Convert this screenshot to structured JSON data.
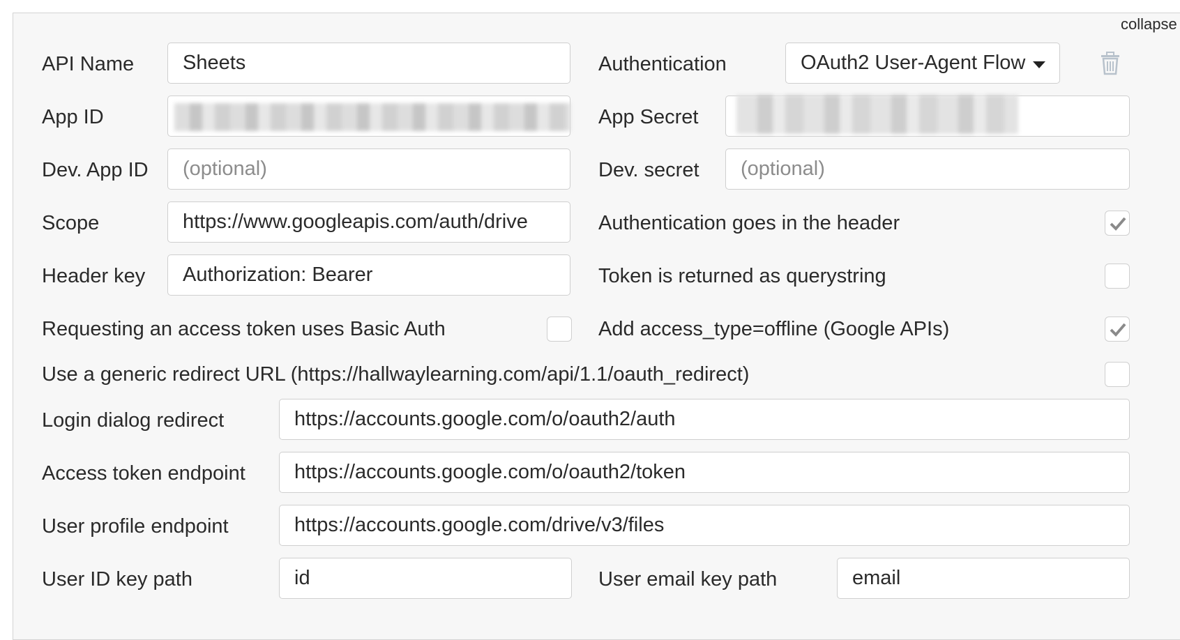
{
  "header": {
    "collapse_label": "collapse"
  },
  "fields": {
    "api_name": {
      "label": "API Name",
      "value": "Sheets"
    },
    "authentication": {
      "label": "Authentication",
      "value": "OAuth2 User-Agent Flow"
    },
    "app_id": {
      "label": "App ID"
    },
    "app_secret": {
      "label": "App Secret"
    },
    "dev_app_id": {
      "label": "Dev. App ID",
      "placeholder": "(optional)"
    },
    "dev_secret": {
      "label": "Dev. secret",
      "placeholder": "(optional)"
    },
    "scope": {
      "label": "Scope",
      "value": "https://www.googleapis.com/auth/drive"
    },
    "header_key": {
      "label": "Header key",
      "value": "Authorization: Bearer"
    },
    "login_dialog_redirect": {
      "label": "Login dialog redirect",
      "value": "https://accounts.google.com/o/oauth2/auth"
    },
    "access_token_endpoint": {
      "label": "Access token endpoint",
      "value": "https://accounts.google.com/o/oauth2/token"
    },
    "user_profile_endpoint": {
      "label": "User profile endpoint",
      "value": "https://accounts.google.com/drive/v3/files"
    },
    "user_id_key_path": {
      "label": "User ID key path",
      "value": "id"
    },
    "user_email_key_path": {
      "label": "User email key path",
      "value": "email"
    }
  },
  "checkboxes": {
    "auth_in_header": {
      "label": "Authentication goes in the header",
      "checked": true
    },
    "token_querystring": {
      "label": "Token is returned as querystring",
      "checked": false
    },
    "basic_auth": {
      "label": "Requesting an access token uses Basic Auth",
      "checked": false
    },
    "access_type_offline": {
      "label": "Add access_type=offline (Google APIs)",
      "checked": true
    },
    "generic_redirect": {
      "label": "Use a generic redirect URL (https://hallwaylearning.com/api/1.1/oauth_redirect)",
      "checked": false
    }
  },
  "icons": {
    "delete": "trash-icon",
    "check": "checkmark-icon",
    "dropdown": "caret-down-icon"
  },
  "colors": {
    "panel_bg": "#f7f7f7",
    "border": "#cfcfcf",
    "checkmark": "#8a8a8a",
    "icon_muted": "#b8c2cc"
  }
}
